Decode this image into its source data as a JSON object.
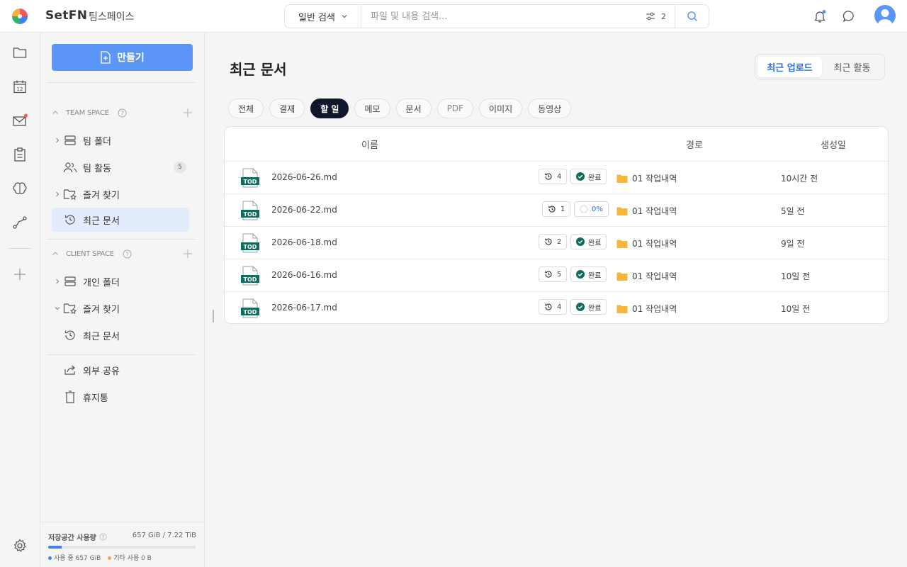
{
  "header": {
    "brand": "SetFN",
    "workspace": "팀스페이스",
    "search_type": "일반 검색",
    "search_placeholder": "파일 및 내용 검색...",
    "filter_count": "2"
  },
  "sidebar": {
    "create_label": "만들기",
    "team_space": {
      "title": "TEAM SPACE",
      "items": [
        {
          "label": "팀 폴더",
          "icon": "server-icon",
          "expandable": true
        },
        {
          "label": "팀 활동",
          "icon": "users-icon",
          "count": "5"
        },
        {
          "label": "즐겨 찾기",
          "icon": "star-folder-icon",
          "expandable": true
        },
        {
          "label": "최근 문서",
          "icon": "history-icon",
          "active": true
        }
      ]
    },
    "client_space": {
      "title": "CLIENT SPACE",
      "items": [
        {
          "label": "개인 폴더",
          "icon": "server-icon"
        },
        {
          "label": "즐겨 찾기",
          "icon": "star-folder-icon"
        },
        {
          "label": "최근 문서",
          "icon": "history-icon"
        }
      ]
    },
    "extra": [
      {
        "label": "외부 공유",
        "icon": "share-icon"
      },
      {
        "label": "휴지통",
        "icon": "trash-icon"
      }
    ],
    "storage": {
      "title": "저장공간 사용량",
      "total": "657 GiB / 7.22 TiB",
      "used_label": "사용 중 657 GiB",
      "other_label": "기타 사용 0 B",
      "used_fraction": 0.089,
      "used_color": "#3d82f5",
      "other_color": "#f5a25b"
    }
  },
  "main": {
    "title": "최근 문서",
    "view_toggle": [
      "최근 업로드",
      "최근 활동"
    ],
    "chips": [
      "전체",
      "결재",
      "할 일",
      "메모",
      "문서",
      "PDF",
      "이미지",
      "동영상"
    ],
    "active_chip": "할 일",
    "columns": {
      "name": "이름",
      "path": "경로",
      "created": "생성일"
    },
    "rows": [
      {
        "name": "2026-06-26.md",
        "versions": "4",
        "status": "완료",
        "path": "01 작업내역",
        "created": "10시간 전"
      },
      {
        "name": "2026-06-22.md",
        "versions": "1",
        "status": "0%",
        "path": "01 작업내역",
        "created": "5일 전"
      },
      {
        "name": "2026-06-18.md",
        "versions": "2",
        "status": "완료",
        "path": "01 작업내역",
        "created": "9일 전"
      },
      {
        "name": "2026-06-16.md",
        "versions": "5",
        "status": "완료",
        "path": "01 작업내역",
        "created": "10일 전"
      },
      {
        "name": "2026-06-17.md",
        "versions": "4",
        "status": "완료",
        "path": "01 작업내역",
        "created": "10일 전"
      }
    ],
    "file_badge": "TOD"
  },
  "colors": {
    "accent": "#5b95f5",
    "done": "#0f6b5c",
    "folder": "#f7b53b"
  }
}
